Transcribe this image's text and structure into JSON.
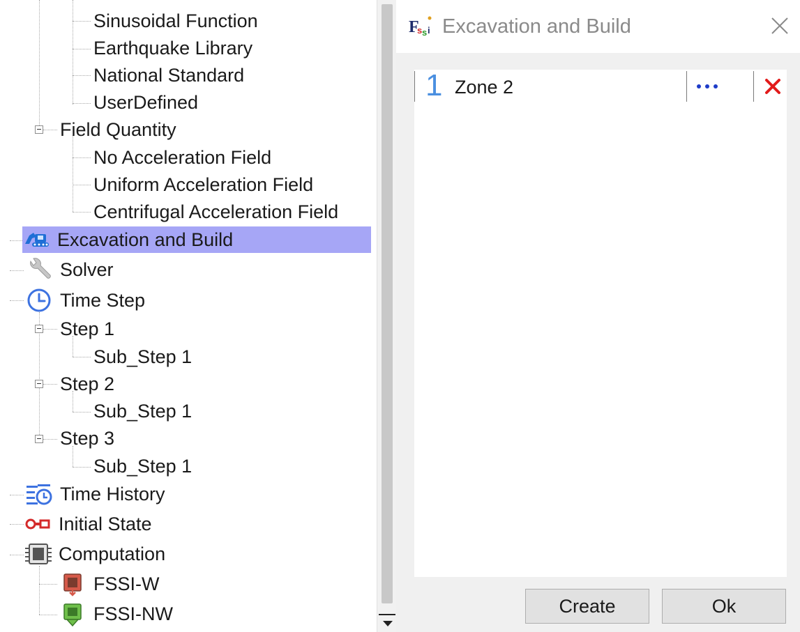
{
  "tree": {
    "items": [
      {
        "label": "Sinusoidal Function"
      },
      {
        "label": "Earthquake Library"
      },
      {
        "label": "National Standard"
      },
      {
        "label": "UserDefined"
      },
      {
        "label": "Field Quantity"
      },
      {
        "label": "No Acceleration Field"
      },
      {
        "label": "Uniform Acceleration Field"
      },
      {
        "label": "Centrifugal Acceleration Field"
      },
      {
        "label": "Excavation and Build",
        "icon": "excavator-icon",
        "selected": true
      },
      {
        "label": "Solver",
        "icon": "wrench-icon"
      },
      {
        "label": "Time Step",
        "icon": "clock-icon"
      },
      {
        "label": "Step 1"
      },
      {
        "label": "Sub_Step 1"
      },
      {
        "label": "Step 2"
      },
      {
        "label": "Sub_Step 1"
      },
      {
        "label": "Step 3"
      },
      {
        "label": "Sub_Step 1"
      },
      {
        "label": "Time History",
        "icon": "time-history-icon"
      },
      {
        "label": "Initial State",
        "icon": "initial-state-icon"
      },
      {
        "label": "Computation",
        "icon": "chip-icon"
      },
      {
        "label": "FSSI-W",
        "icon": "fssi-w-icon"
      },
      {
        "label": "FSSI-NW",
        "icon": "fssi-nw-icon"
      }
    ]
  },
  "dialog": {
    "logo_text": "Fssi",
    "title": "Excavation and Build",
    "zones": [
      {
        "index": "1",
        "name": "Zone 2"
      }
    ],
    "create_label": "Create",
    "ok_label": "Ok"
  },
  "colors": {
    "selection": "#a6a6f6",
    "zone_index": "#4a8fe0",
    "delete": "#e21b1b",
    "more_dots": "#1e3cc8"
  }
}
